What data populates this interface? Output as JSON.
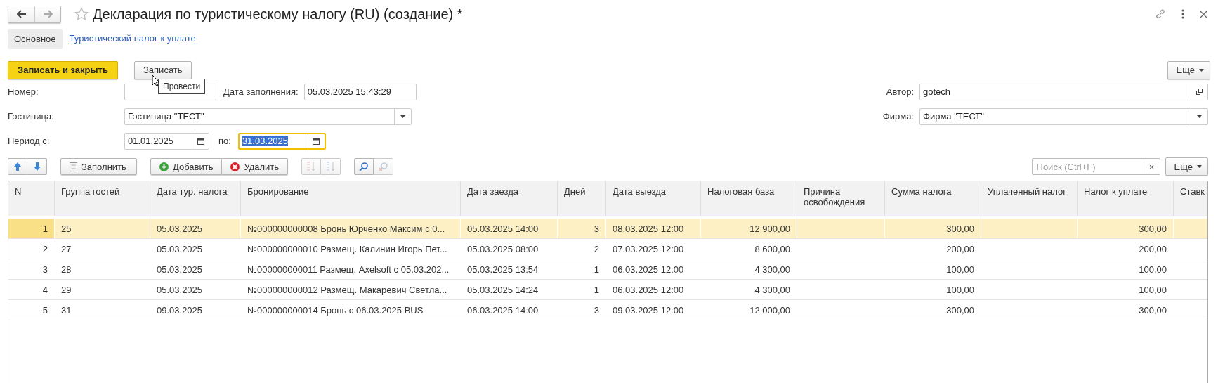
{
  "window": {
    "title": "Декларация по туристическому налогу (RU) (создание) *"
  },
  "tabs": [
    {
      "label": "Основное",
      "selected": true
    },
    {
      "label": "Туристический налог к уплате",
      "selected": false
    }
  ],
  "command_bar": {
    "primary": "Записать и закрыть",
    "secondary": "Записать",
    "more": "Еще",
    "tooltip": "Провести"
  },
  "fields": {
    "number": {
      "label": "Номер:"
    },
    "fill_date": {
      "label": "Дата заполнения:",
      "value": "05.03.2025 15:43:29"
    },
    "author": {
      "label": "Автор:",
      "value": "gotech"
    },
    "hotel": {
      "label": "Гостиница:",
      "value": "Гостиница \"ТЕСТ\""
    },
    "firm": {
      "label": "Фирма:",
      "value": "Фирма \"ТЕСТ\""
    },
    "period_from": {
      "label": "Период с:",
      "value": "01.01.2025"
    },
    "period_to": {
      "label": "по:",
      "value": "31.03.2025",
      "focused": true
    }
  },
  "table_toolbar": {
    "fill": "Заполнить",
    "add": "Добавить",
    "delete": "Удалить",
    "search_placeholder": "Поиск (Ctrl+F)",
    "clear": "×",
    "more": "Еще"
  },
  "table": {
    "columns": [
      "N",
      "Группа гостей",
      "Дата тур. налога",
      "Бронирование",
      "Дата заезда",
      "Дней",
      "Дата выезда",
      "Налоговая база",
      "Причина освобождения",
      "Сумма налога",
      "Уплаченный налог",
      "Налог к уплате",
      "Ставк"
    ],
    "rows": [
      {
        "selected": true,
        "cells": [
          "1",
          "25",
          "05.03.2025",
          "№000000000008 Бронь Юрченко Максим с 0...",
          "05.03.2025 14:00",
          "3",
          "08.03.2025 12:00",
          "12 900,00",
          "",
          "300,00",
          "",
          "300,00",
          ""
        ]
      },
      {
        "selected": false,
        "cells": [
          "2",
          "27",
          "05.03.2025",
          "№000000000010 Размещ. Калинин Игорь Пет...",
          "05.03.2025 08:00",
          "2",
          "07.03.2025 12:00",
          "8 600,00",
          "",
          "200,00",
          "",
          "200,00",
          ""
        ]
      },
      {
        "selected": false,
        "cells": [
          "3",
          "28",
          "05.03.2025",
          "№000000000011 Размещ. Axelsoft с 05.03.202...",
          "05.03.2025 13:54",
          "1",
          "06.03.2025 12:00",
          "4 300,00",
          "",
          "100,00",
          "",
          "100,00",
          ""
        ]
      },
      {
        "selected": false,
        "cells": [
          "4",
          "29",
          "05.03.2025",
          "№000000000012 Размещ. Макаревич Светла...",
          "05.03.2025 14:24",
          "1",
          "06.03.2025 12:00",
          "4 300,00",
          "",
          "100,00",
          "",
          "100,00",
          ""
        ]
      },
      {
        "selected": false,
        "cells": [
          "5",
          "31",
          "09.03.2025",
          "№000000000014 Бронь с 06.03.2025 BUS",
          "06.03.2025 14:00",
          "3",
          "09.03.2025 12:00",
          "12 000,00",
          "",
          "300,00",
          "",
          "300,00",
          ""
        ]
      }
    ]
  }
}
